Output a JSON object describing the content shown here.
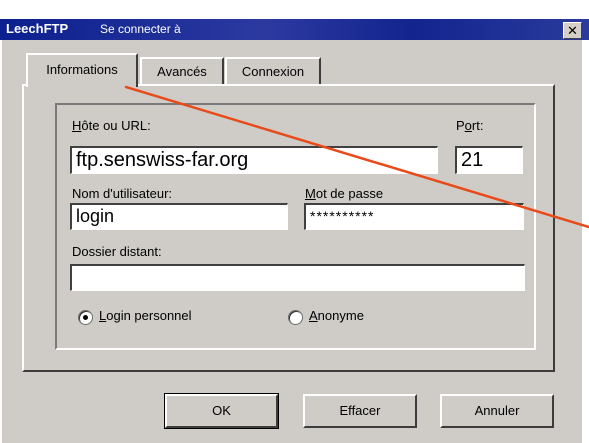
{
  "window": {
    "app_name": "LeechFTP",
    "title_rest": "Se connecter à",
    "close_glyph": "✕"
  },
  "tabs": [
    {
      "label": "Informations",
      "active": true
    },
    {
      "label": "Avancés",
      "active": false
    },
    {
      "label": "Connexion",
      "active": false
    }
  ],
  "form": {
    "host_label_first": "H",
    "host_label_rest": "ôte ou URL:",
    "host_value": "ftp.senswiss-far.org",
    "port_label_first": "P",
    "port_label_underlined": "o",
    "port_label_rest": "rt:",
    "port_value": "21",
    "user_label": "Nom d'utilisateur:",
    "user_value": "login",
    "password_label_first": "M",
    "password_label_rest": "ot de passe",
    "password_value": "**********",
    "remote_dir_label": "Dossier distant:",
    "remote_dir_value": ""
  },
  "login_mode": {
    "personal_first": "L",
    "personal_rest": "ogin personnel",
    "anonymous_first": "A",
    "anonymous_rest": "nonyme",
    "selected": "personal"
  },
  "buttons": {
    "ok": "OK",
    "clear": "Effacer",
    "cancel": "Annuler"
  },
  "colors": {
    "title_bar": "#0b1f8e",
    "annotation_line": "#e84a1a",
    "dialog_face": "#cfccc8"
  }
}
